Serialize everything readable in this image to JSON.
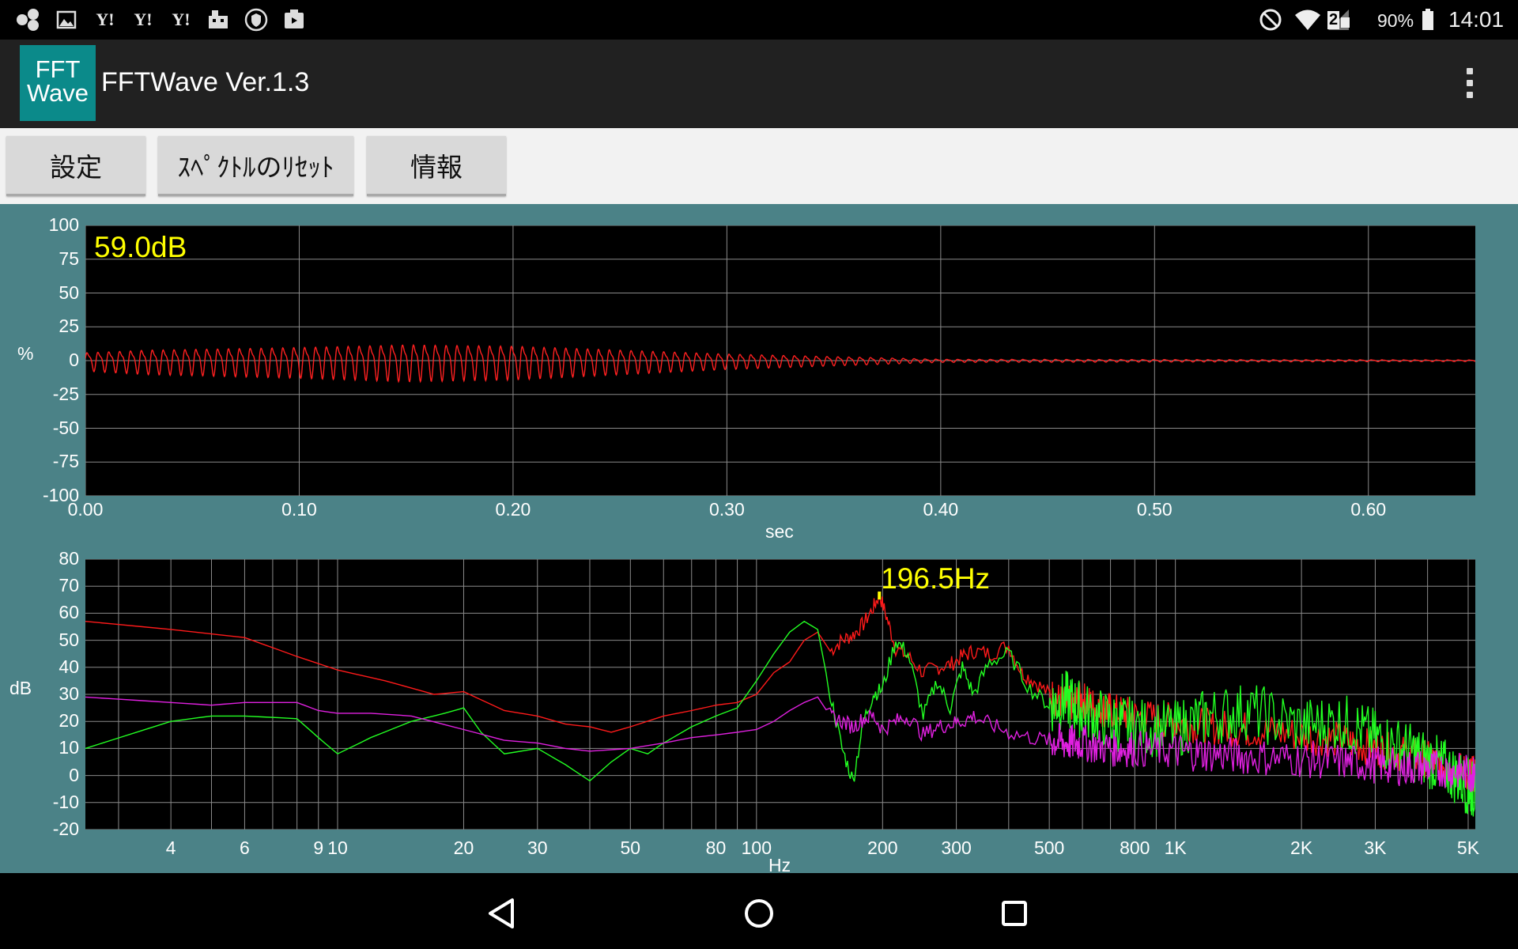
{
  "status_bar": {
    "battery": "90%",
    "time": "14:01",
    "notification_icons": [
      "bubbles-icon",
      "image-icon",
      "yahoo-icon",
      "yahoo-icon",
      "yahoo-icon",
      "hotel-icon",
      "shield-icon",
      "clipboard-icon"
    ],
    "system_icons": [
      "do-not-disturb-icon",
      "wifi-icon",
      "signal-icon",
      "battery-icon"
    ],
    "signal_badge": "2"
  },
  "app_bar": {
    "logo_line1": "FFT",
    "logo_line2": "Wave",
    "title": "FFTWave Ver.1.3",
    "menu_icon": "overflow-menu-icon"
  },
  "toolbar": {
    "settings_label": "設定",
    "reset_label": "ｽﾍﾟｸﾄﾙのﾘｾｯﾄ",
    "info_label": "情報"
  },
  "colors": {
    "background": "#4b8287",
    "plot_bg": "#000000",
    "grid": "#8a8a8a",
    "waveform": "#ff2020",
    "peak_label": "#ffff00",
    "spectrum_max": "#ff1a1a",
    "spectrum_current": "#22ff22",
    "spectrum_avg": "#e020e0"
  },
  "chart_data": [
    {
      "type": "line",
      "name": "waveform",
      "ylabel": "%",
      "xlabel": "sec",
      "annotation": "59.0dB",
      "xlim": [
        0,
        0.65
      ],
      "ylim": [
        -100,
        100
      ],
      "x_ticks": [
        "0.00",
        "0.10",
        "0.20",
        "0.30",
        "0.40",
        "0.50",
        "0.60"
      ],
      "y_ticks": [
        "100",
        "75",
        "50",
        "25",
        "0",
        "-25",
        "-50",
        "-75",
        "-100"
      ],
      "grid": true,
      "series": [
        {
          "color": "#ff2020",
          "oscillation_hz": 196.5,
          "envelope": {
            "t": [
              0.0,
              0.03,
              0.1,
              0.15,
              0.2,
              0.25,
              0.3,
              0.35,
              0.4,
              0.5,
              0.6,
              0.65
            ],
            "amp": [
              6,
              8,
              10,
              12,
              11,
              8,
              5,
              3,
              1,
              0.8,
              0.6,
              0.5
            ]
          }
        }
      ]
    },
    {
      "type": "line",
      "name": "spectrum",
      "ylabel": "dB",
      "xlabel": "Hz",
      "x_scale": "log",
      "annotation": "196.5Hz",
      "peak_hz": 196.5,
      "xlim": [
        2.5,
        5200
      ],
      "ylim": [
        -20,
        80
      ],
      "x_ticks": [
        {
          "v": 4,
          "label": "4"
        },
        {
          "v": 6,
          "label": "6"
        },
        {
          "v": 9,
          "label": "9"
        },
        {
          "v": 10,
          "label": "10"
        },
        {
          "v": 20,
          "label": "20"
        },
        {
          "v": 30,
          "label": "30"
        },
        {
          "v": 50,
          "label": "50"
        },
        {
          "v": 80,
          "label": "80"
        },
        {
          "v": 100,
          "label": "100"
        },
        {
          "v": 200,
          "label": "200"
        },
        {
          "v": 300,
          "label": "300"
        },
        {
          "v": 500,
          "label": "500"
        },
        {
          "v": 800,
          "label": "800"
        },
        {
          "v": 1000,
          "label": "1K"
        },
        {
          "v": 2000,
          "label": "2K"
        },
        {
          "v": 3000,
          "label": "3K"
        },
        {
          "v": 5000,
          "label": "5K"
        }
      ],
      "y_ticks": [
        "80",
        "70",
        "60",
        "50",
        "40",
        "30",
        "20",
        "10",
        "0",
        "-10",
        "-20"
      ],
      "grid": true,
      "series": [
        {
          "color": "#ff1a1a",
          "x": [
            2.5,
            4,
            6,
            8,
            10,
            13,
            17,
            20,
            25,
            30,
            35,
            40,
            45,
            50,
            60,
            70,
            80,
            90,
            100,
            110,
            120,
            130,
            140,
            150,
            160,
            170,
            180,
            190,
            196.5,
            205,
            215,
            230,
            250,
            270,
            290,
            310,
            330,
            360,
            400,
            430,
            460,
            500,
            550,
            600,
            650,
            700,
            800,
            1000,
            1200,
            1500,
            2000,
            2500,
            3000,
            3500,
            4000,
            4500,
            5000,
            5200
          ],
          "y": [
            57,
            54,
            51,
            44,
            39,
            35,
            30,
            31,
            24,
            22,
            19,
            18,
            16,
            18,
            22,
            24,
            26,
            27,
            30,
            38,
            42,
            50,
            53,
            46,
            50,
            52,
            56,
            62,
            67,
            58,
            47,
            44,
            38,
            40,
            41,
            44,
            46,
            45,
            48,
            38,
            35,
            30,
            26,
            28,
            25,
            24,
            22,
            20,
            18,
            17,
            15,
            13,
            10,
            8,
            6,
            3,
            1,
            0
          ]
        },
        {
          "color": "#22ff22",
          "x": [
            2.5,
            4,
            5,
            6,
            8,
            9,
            10,
            12,
            15,
            18,
            20,
            22,
            25,
            30,
            35,
            40,
            45,
            50,
            55,
            60,
            70,
            80,
            90,
            100,
            110,
            120,
            130,
            140,
            150,
            160,
            170,
            180,
            190,
            200,
            215,
            230,
            250,
            270,
            290,
            310,
            330,
            360,
            400,
            450,
            500,
            550,
            600,
            700,
            800,
            1000,
            1200,
            1500,
            2000,
            2500,
            3000,
            3500,
            4000,
            4500,
            5000,
            5200
          ],
          "y": [
            10,
            20,
            22,
            22,
            21,
            14,
            8,
            14,
            20,
            23,
            25,
            16,
            8,
            10,
            4,
            -2,
            5,
            10,
            8,
            12,
            18,
            22,
            25,
            35,
            45,
            53,
            57,
            54,
            30,
            10,
            -2,
            20,
            30,
            32,
            50,
            45,
            22,
            35,
            25,
            40,
            30,
            42,
            45,
            32,
            26,
            28,
            24,
            20,
            18,
            17,
            22,
            24,
            18,
            20,
            14,
            10,
            6,
            2,
            -4,
            -6
          ]
        },
        {
          "color": "#e020e0",
          "x": [
            2.5,
            4,
            5,
            6,
            8,
            9,
            10,
            12,
            15,
            20,
            25,
            30,
            35,
            40,
            50,
            60,
            70,
            80,
            90,
            100,
            110,
            120,
            130,
            140,
            150,
            160,
            170,
            180,
            190,
            200,
            215,
            230,
            250,
            270,
            290,
            310,
            330,
            360,
            400,
            450,
            500,
            550,
            600,
            700,
            800,
            1000,
            1200,
            1500,
            2000,
            2500,
            3000,
            3500,
            4000,
            4500,
            5000,
            5200
          ],
          "y": [
            29,
            27,
            26,
            27,
            27,
            24,
            23,
            23,
            22,
            17,
            13,
            12,
            10,
            9,
            10,
            12,
            14,
            15,
            16,
            17,
            20,
            24,
            27,
            29,
            22,
            20,
            18,
            21,
            22,
            17,
            20,
            22,
            15,
            18,
            19,
            20,
            22,
            19,
            16,
            14,
            13,
            12,
            12,
            10,
            10,
            9,
            8,
            7,
            6,
            5,
            4,
            3,
            3,
            2,
            1,
            0
          ]
        }
      ]
    }
  ],
  "nav_bar": {
    "back_icon": "back-icon",
    "home_icon": "home-icon",
    "recents_icon": "recents-icon"
  }
}
